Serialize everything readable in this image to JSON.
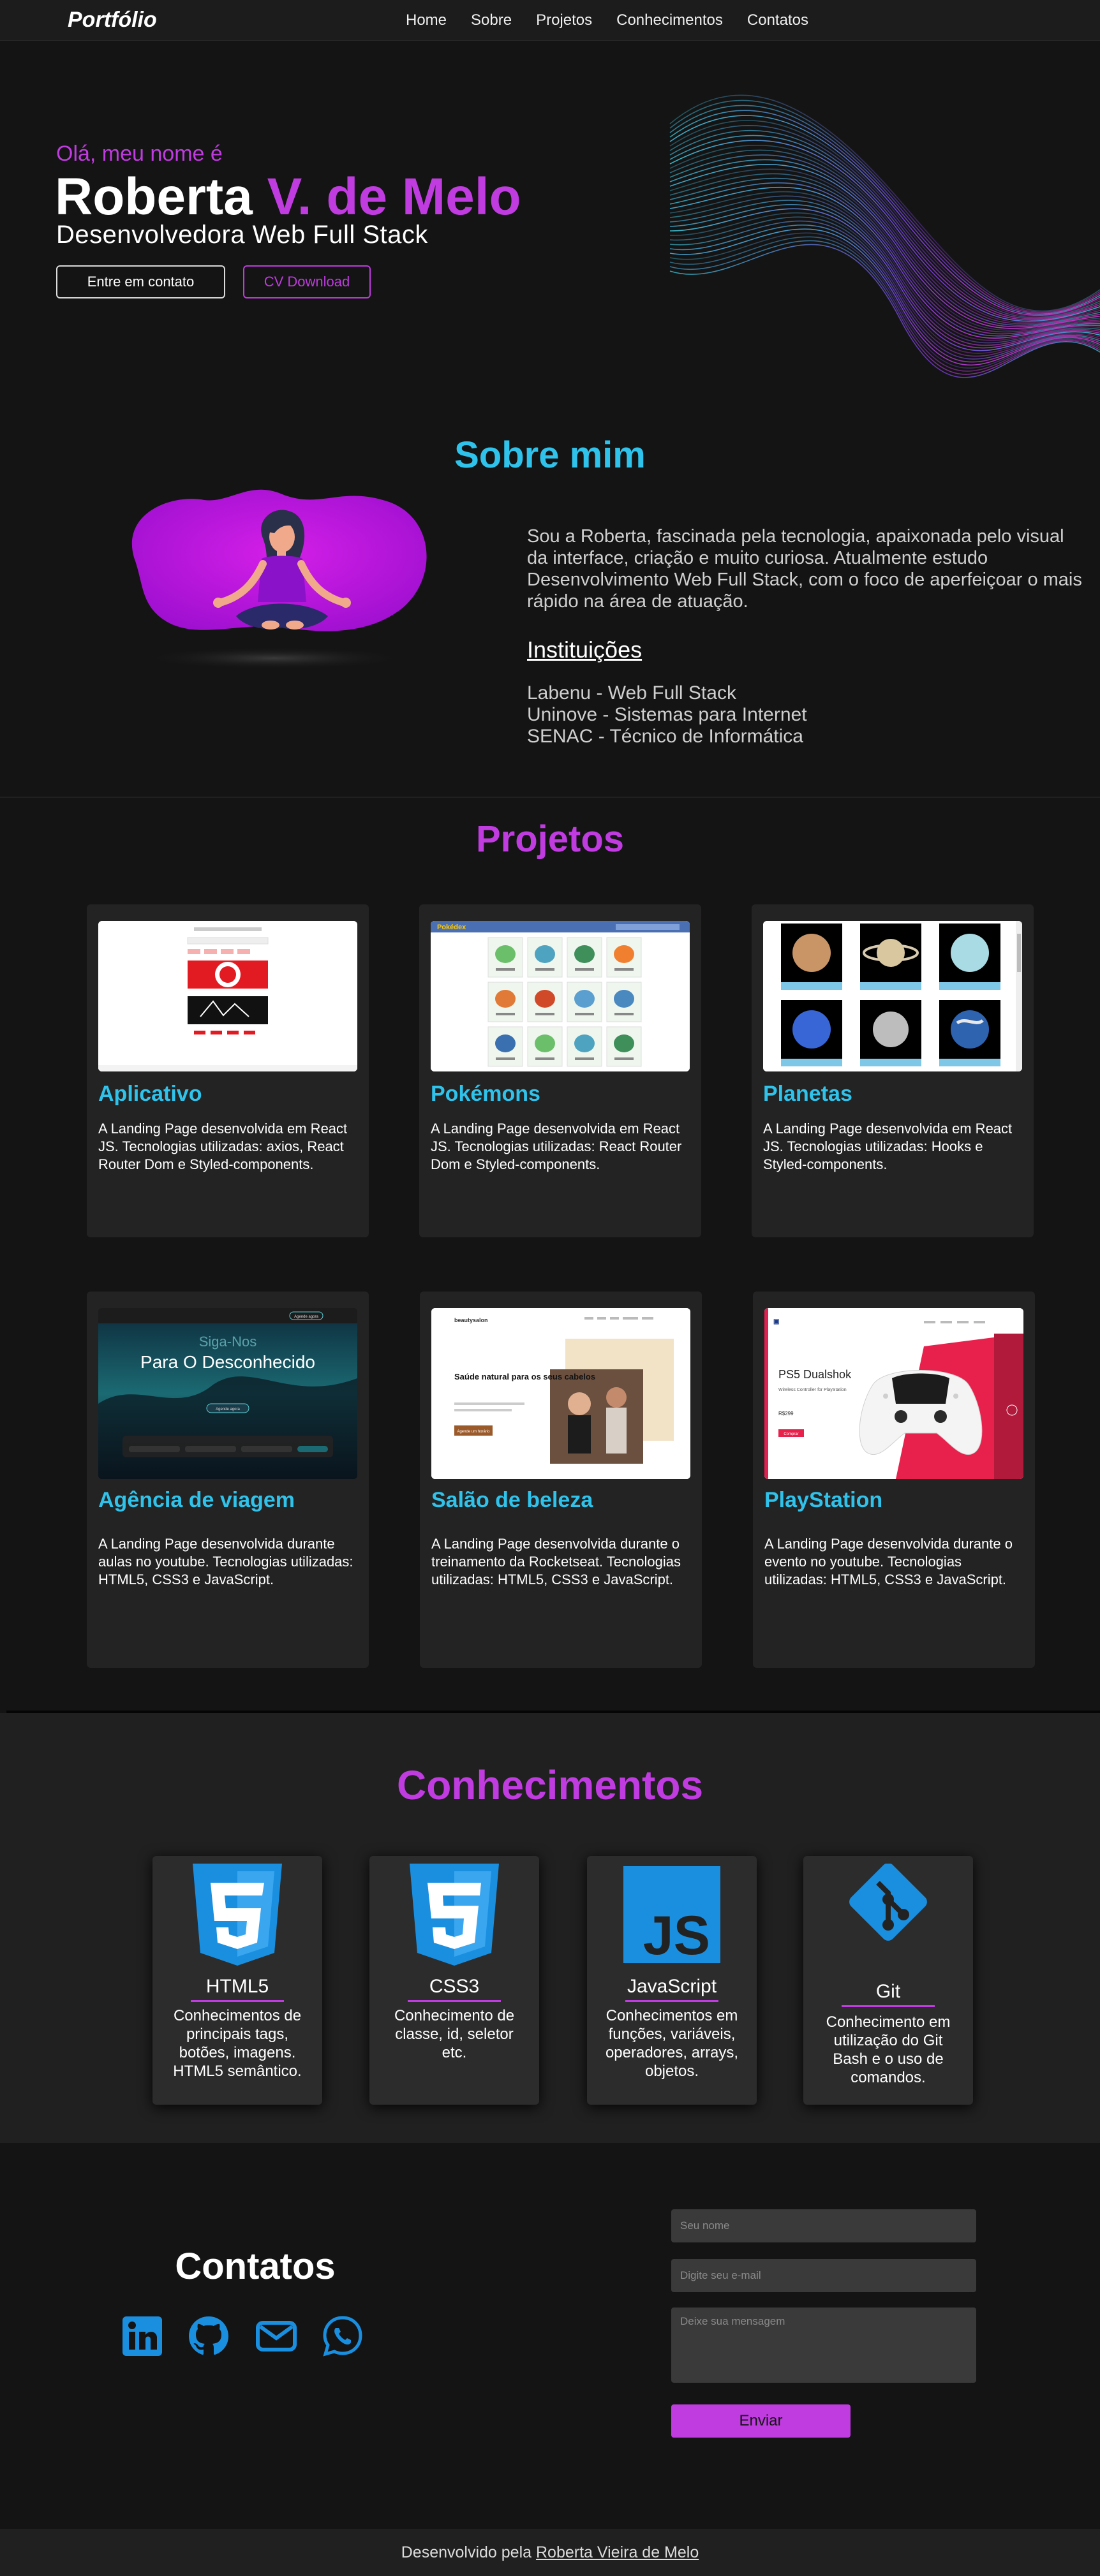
{
  "nav": {
    "brand": "Portfólio",
    "items": [
      "Home",
      "Sobre",
      "Projetos",
      "Conhecimentos",
      "Contatos"
    ]
  },
  "hero": {
    "greeting": "Olá, meu nome é",
    "name_first": "Roberta",
    "name_rest": "V. de Melo",
    "role": "Desenvolvedora Web Full Stack",
    "btn_contact": "Entre em contato",
    "btn_cv": "CV Download"
  },
  "sobre": {
    "title": "Sobre mim",
    "bio": "Sou a Roberta, fascinada pela tecnologia, apaixonada pelo visual da interface, criação e muito curiosa. Atualmente estudo Desenvolvimento Web Full Stack, com o foco de aperfeiçoar o mais rápido na área de atuação.",
    "inst_title": "Instituições",
    "institutions": [
      "Labenu - Web Full Stack",
      "Uninove - Sistemas para Internet",
      "SENAC - Técnico de Informática"
    ]
  },
  "projetos": {
    "title": "Projetos",
    "cards": [
      {
        "title": "Aplicativo",
        "desc": "A Landing Page desenvolvida em React JS. Tecnologias utilizadas: axios, React Router Dom e Styled-components."
      },
      {
        "title": "Pokémons",
        "desc": "A Landing Page desenvolvida em React JS. Tecnologias utilizadas: React Router Dom e Styled-components."
      },
      {
        "title": "Planetas",
        "desc": "A Landing Page desenvolvida em React JS. Tecnologias utilizadas: Hooks e Styled-components."
      },
      {
        "title": "Agência de viagem",
        "desc": "A Landing Page desenvolvida durante aulas no youtube. Tecnologias utilizadas: HTML5, CSS3 e JavaScript."
      },
      {
        "title": "Salão de beleza",
        "desc": "A Landing Page desenvolvida durante o treinamento da Rocketseat. Tecnologias utilizadas: HTML5, CSS3 e JavaScript."
      },
      {
        "title": "PlayStation",
        "desc": "A Landing Page desenvolvida durante o evento no youtube. Tecnologias utilizadas: HTML5, CSS3 e JavaScript."
      }
    ],
    "shots": {
      "pokedex_title": "Pokédex",
      "travel_nav_btn": "Agende agora",
      "travel_headline_1": "Siga-Nos",
      "travel_headline_2": "Para O Desconhecido",
      "travel_btn": "Agende agora",
      "salon_logo": "beautysalon",
      "salon_headline": "Saúde natural para os seus cabelos",
      "salon_btn": "Agende um horário",
      "ps_headline": "PS5 Dualshok",
      "ps_sub": "Wireless Controller for PlayStation",
      "ps_price": "R$299",
      "ps_btn": "Comprar"
    }
  },
  "conhecimentos": {
    "title": "Conhecimentos",
    "skills": [
      {
        "name": "HTML5",
        "desc": "Conhecimentos de principais tags, botões, imagens. HTML5 semântico.",
        "icon": "html5-icon"
      },
      {
        "name": "CSS3",
        "desc": "Conhecimento de classe, id, seletor etc.",
        "icon": "css3-icon"
      },
      {
        "name": "JavaScript",
        "desc": "Conhecimentos em funções, variáveis, operadores, arrays, objetos.",
        "icon": "js-icon"
      },
      {
        "name": "Git",
        "desc": "Conhecimento em utilização do Git Bash e o uso de comandos.",
        "icon": "git-icon"
      }
    ]
  },
  "contatos": {
    "title": "Contatos",
    "social": [
      "linkedin-icon",
      "github-icon",
      "email-icon",
      "whatsapp-icon"
    ],
    "form": {
      "name_placeholder": "Seu nome",
      "email_placeholder": "Digite seu e-mail",
      "message_placeholder": "Deixe sua mensagem",
      "send_label": "Enviar"
    }
  },
  "footer": {
    "prefix": "Desenvolvido pela",
    "author": "Roberta Vieira de Melo"
  },
  "colors": {
    "accent_purple": "#c03be0",
    "accent_cyan": "#2fc3ec",
    "icon_blue": "#1a8fe0"
  }
}
